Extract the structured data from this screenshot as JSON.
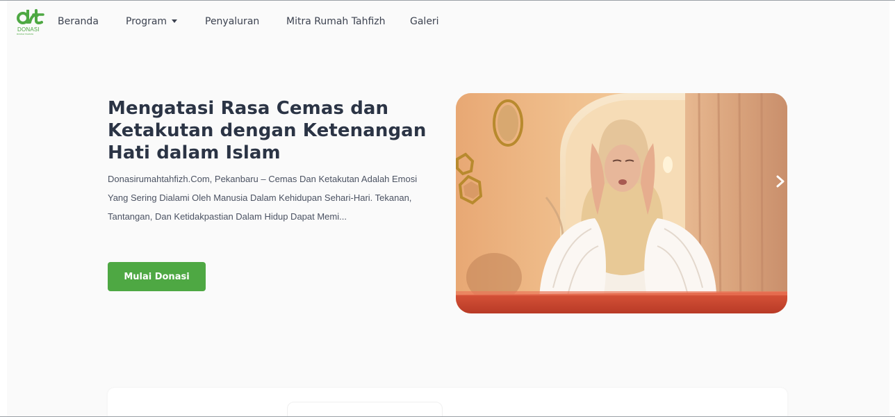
{
  "brand": {
    "logo_word": "DONASI",
    "logo_sub": "RUMAH TAHFIZH",
    "accent_color": "#4ea843"
  },
  "nav": {
    "items": [
      {
        "label": "Beranda"
      },
      {
        "label": "Program",
        "has_dropdown": true
      },
      {
        "label": "Penyaluran"
      },
      {
        "label": "Mitra Rumah Tahfizh"
      },
      {
        "label": "Galeri"
      }
    ]
  },
  "hero": {
    "title": "Mengatasi Rasa Cemas dan Ketakutan dengan Ketenangan Hati dalam Islam",
    "excerpt": "Donasirumahtahfizh.Com, Pekanbaru – Cemas Dan Ketakutan Adalah Emosi Yang Sering Dialami Oleh Manusia Dalam Kehidupan Sehari-Hari. Tekanan, Tantangan, Dan Ketidakpastian Dalam Hidup Dapat Memi...",
    "cta_label": "Mulai Donasi",
    "image_icon": "article-photo",
    "next_icon": "chevron-right-icon"
  },
  "colors": {
    "page_background": "#fafafa",
    "text": "#2b3445",
    "button_background": "#4ea843"
  }
}
